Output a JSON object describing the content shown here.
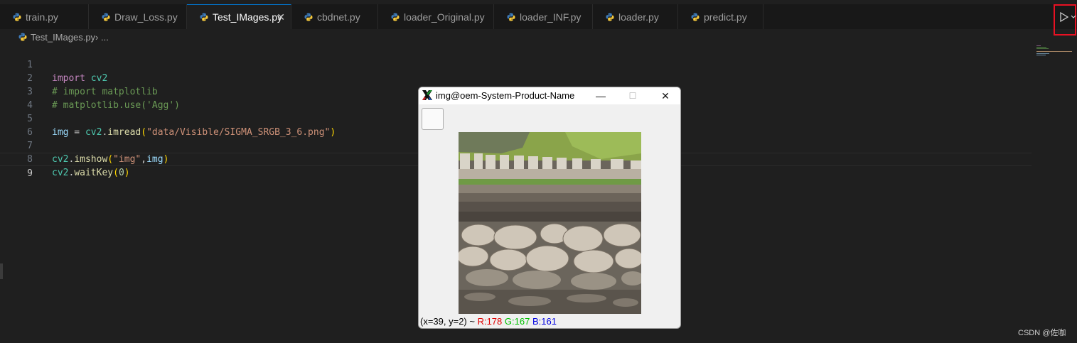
{
  "tabs": [
    {
      "label": "train.py"
    },
    {
      "label": "Draw_Loss.py"
    },
    {
      "label": "Test_IMages.py",
      "close": "✕"
    },
    {
      "label": "cbdnet.py"
    },
    {
      "label": "loader_Original.py"
    },
    {
      "label": "loader_INF.py"
    },
    {
      "label": "loader.py"
    },
    {
      "label": "predict.py"
    }
  ],
  "breadcrumb": {
    "file": "Test_IMages.py",
    "sep": " › ..."
  },
  "lines": [
    "1",
    "2",
    "3",
    "4",
    "5",
    "6",
    "7",
    "8",
    "9"
  ],
  "code": {
    "l1_import": "import",
    "l1_mod": " cv2",
    "l2": "# import matplotlib",
    "l3": "# matplotlib.use('Agg')",
    "l5_img": "img",
    "l5_eq": " = ",
    "l5_cv2": "cv2",
    "l5_dot": ".",
    "l5_fn": "imread",
    "l5_open": "(",
    "l5_str": "\"data/Visible/SIGMA_SRGB_3_6.png\"",
    "l5_close": ")",
    "l7_cv2": "cv2",
    "l7_dot": ".",
    "l7_fn": "imshow",
    "l7_open": "(",
    "l7_str": "\"img\"",
    "l7_comma": ",",
    "l7_img": "img",
    "l7_close": ")",
    "l8_cv2": "cv2",
    "l8_dot": ".",
    "l8_fn": "waitKey",
    "l8_open": "(",
    "l8_num": "0",
    "l8_close": ")"
  },
  "cv_window": {
    "title": "img@oem-System-Product-Name",
    "minimize": "—",
    "maximize": "☐",
    "close": "✕",
    "status_prefix": "(x=39, y=2) ~ ",
    "r": "R:178",
    "g": "G:167",
    "b": "B:161"
  },
  "watermark": "CSDN @佐咖",
  "colors": {
    "accent": "#0078d4",
    "highlight_box": "#e81123"
  }
}
